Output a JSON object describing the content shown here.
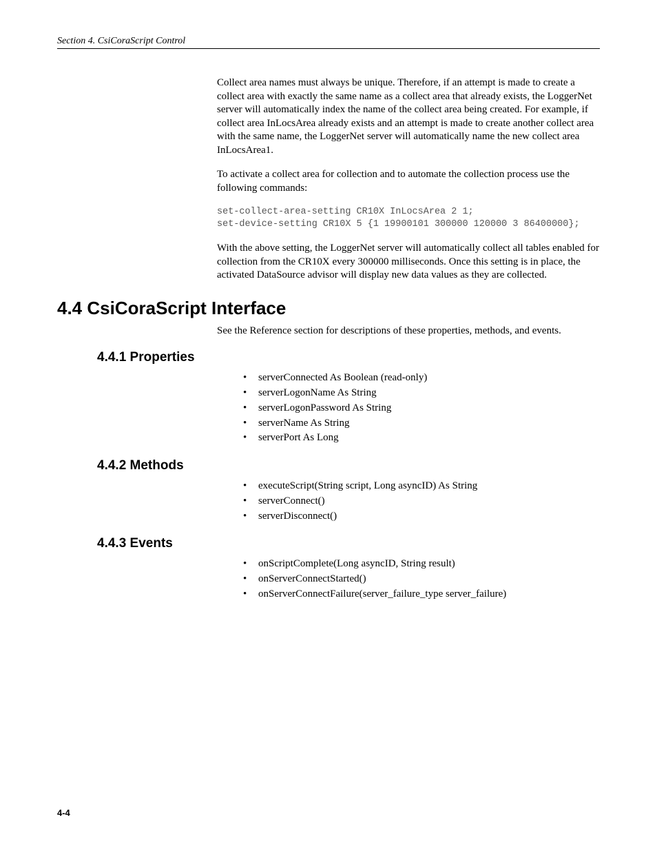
{
  "header": {
    "running": "Section 4.  CsiCoraScript Control"
  },
  "paras": {
    "p1": "Collect area names must always be unique.  Therefore, if an attempt is made to create a collect area with exactly the same name as a collect area that already exists, the LoggerNet server will automatically index the name of the collect area being created.  For example, if collect area InLocsArea already exists and an attempt is made to create another collect area with the same name, the LoggerNet server will automatically name the new collect area InLocsArea1.",
    "p2": "To activate a collect area for collection and to automate the collection process use the following commands:",
    "code": "set-collect-area-setting CR10X InLocsArea 2 1;\nset-device-setting CR10X 5 {1 19900101 300000 120000 3 86400000};",
    "p3": "With the above setting, the LoggerNet server will automatically collect all tables enabled for collection from the CR10X every 300000 milliseconds.  Once this setting is in place, the activated DataSource advisor will display new data values as they are collected.",
    "p4": "See the Reference section for descriptions of these properties, methods, and events."
  },
  "headings": {
    "h2": "4.4  CsiCoraScript Interface",
    "h3a": "4.4.1  Properties",
    "h3b": "4.4.2  Methods",
    "h3c": "4.4.3  Events"
  },
  "lists": {
    "properties": [
      "serverConnected As Boolean (read-only)",
      "serverLogonName As String",
      "serverLogonPassword As String",
      "serverName As String",
      "serverPort As Long"
    ],
    "methods": [
      "executeScript(String script, Long asyncID) As String",
      "serverConnect()",
      "serverDisconnect()"
    ],
    "events": [
      "onScriptComplete(Long asyncID, String result)",
      "onServerConnectStarted()",
      "onServerConnectFailure(server_failure_type server_failure)"
    ]
  },
  "footer": {
    "pageNumber": "4-4"
  }
}
